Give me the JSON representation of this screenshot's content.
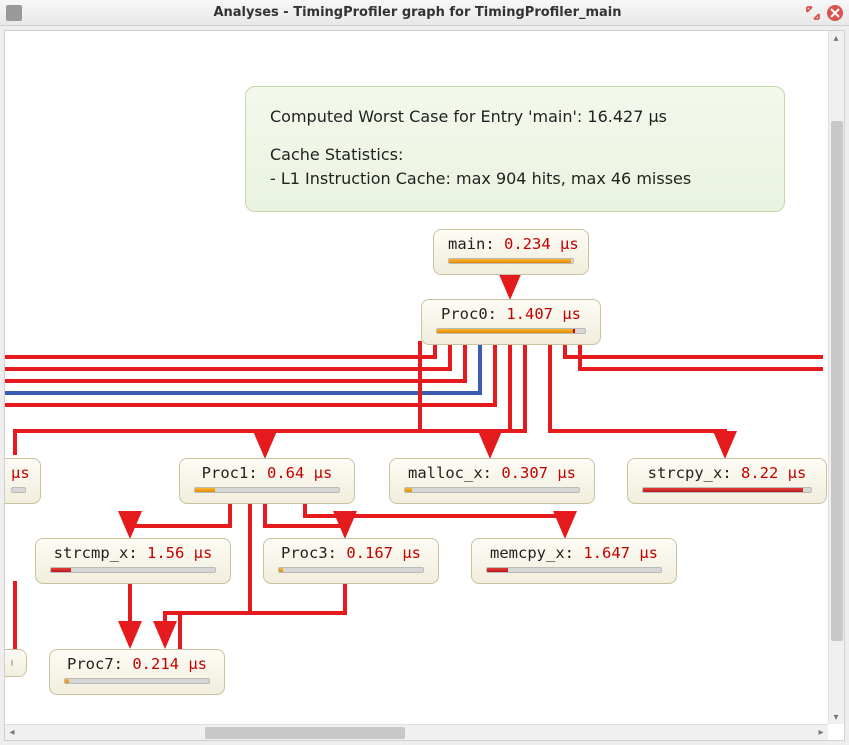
{
  "window": {
    "title": "Analyses - TimingProfiler graph for TimingProfiler_main"
  },
  "summary": {
    "worst_case": "Computed Worst Case for Entry 'main': 16.427 µs",
    "cache_title": "Cache Statistics:",
    "cache_l1": " - L1 Instruction Cache: max 904 hits, max 46 misses"
  },
  "nodes": {
    "main": {
      "name": "main",
      "sep": ": ",
      "value": "0.234 µs"
    },
    "proc0": {
      "name": "Proc0",
      "sep": ": ",
      "value": "1.407 µs"
    },
    "proc1": {
      "name": "Proc1",
      "sep": ": ",
      "value": "0.64 µs"
    },
    "mallocx": {
      "name": "malloc_x",
      "sep": ": ",
      "value": "0.307 µs"
    },
    "strcpyx": {
      "name": "strcpy_x",
      "sep": ": ",
      "value": "8.22 µs"
    },
    "strcmpx": {
      "name": "strcmp_x",
      "sep": ": ",
      "value": "1.56 µs"
    },
    "proc3": {
      "name": "Proc3",
      "sep": ": ",
      "value": "0.167 µs"
    },
    "memcpyx": {
      "name": "memcpy_x",
      "sep": ": ",
      "value": "1.647 µs"
    },
    "proc7": {
      "name": "Proc7",
      "sep": ": ",
      "value": "0.214 µs"
    },
    "clip_left": {
      "suffix": "µs"
    },
    "clip_bl": {
      "suffix": ""
    }
  },
  "colors": {
    "edge_red": "#e41a1c",
    "edge_blue": "#3b5bb5",
    "node_bg_top": "#fdfcf5",
    "node_bg_bot": "#f1eedd",
    "info_bg_top": "#f3f8ed",
    "info_bg_bot": "#eaf3df"
  }
}
